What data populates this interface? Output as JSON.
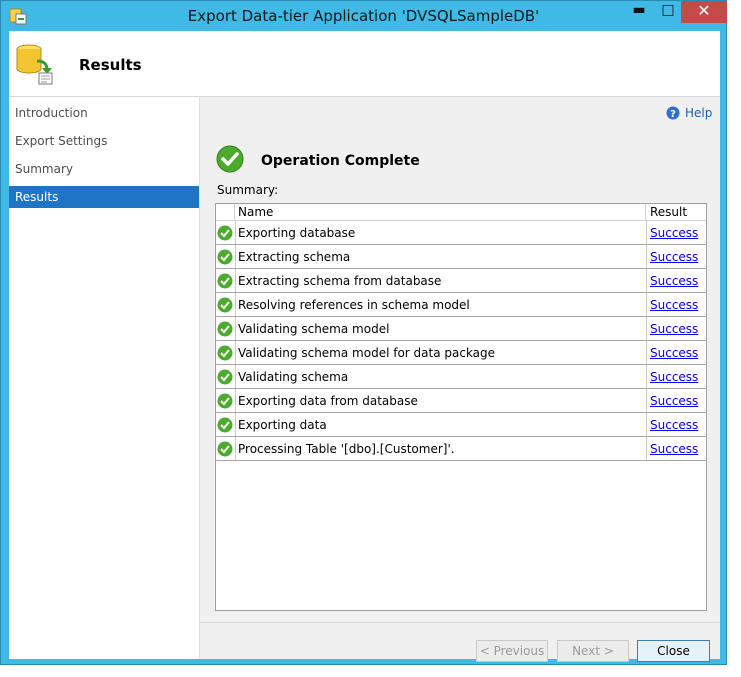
{
  "window": {
    "title": "Export Data-tier Application 'DVSQLSampleDB'",
    "controls": {
      "minimize": "▬",
      "maximize": "□",
      "close": "✕"
    }
  },
  "header": {
    "title": "Results",
    "icon": "database-export-icon"
  },
  "sidebar": {
    "items": [
      {
        "label": "Introduction",
        "active": false
      },
      {
        "label": "Export Settings",
        "active": false
      },
      {
        "label": "Summary",
        "active": false
      },
      {
        "label": "Results",
        "active": true
      }
    ]
  },
  "main": {
    "help_label": "Help",
    "status_text": "Operation Complete",
    "summary_label": "Summary:",
    "table": {
      "columns": [
        "Name",
        "Result"
      ],
      "rows": [
        {
          "name": "Exporting database",
          "result": "Success"
        },
        {
          "name": "Extracting schema",
          "result": "Success"
        },
        {
          "name": "Extracting schema from database",
          "result": "Success"
        },
        {
          "name": "Resolving references in schema model",
          "result": "Success"
        },
        {
          "name": "Validating schema model",
          "result": "Success"
        },
        {
          "name": "Validating schema model for data package",
          "result": "Success"
        },
        {
          "name": "Validating schema",
          "result": "Success"
        },
        {
          "name": "Exporting data from database",
          "result": "Success"
        },
        {
          "name": "Exporting data",
          "result": "Success"
        },
        {
          "name": "Processing Table '[dbo].[Customer]'.",
          "result": "Success"
        }
      ]
    }
  },
  "footer": {
    "previous_label": "< Previous",
    "next_label": "Next >",
    "close_label": "Close"
  },
  "colors": {
    "accent": "#1e75c5",
    "frame": "#3fb9e6",
    "success": "#3a9a2a",
    "link": "#0000ee"
  }
}
